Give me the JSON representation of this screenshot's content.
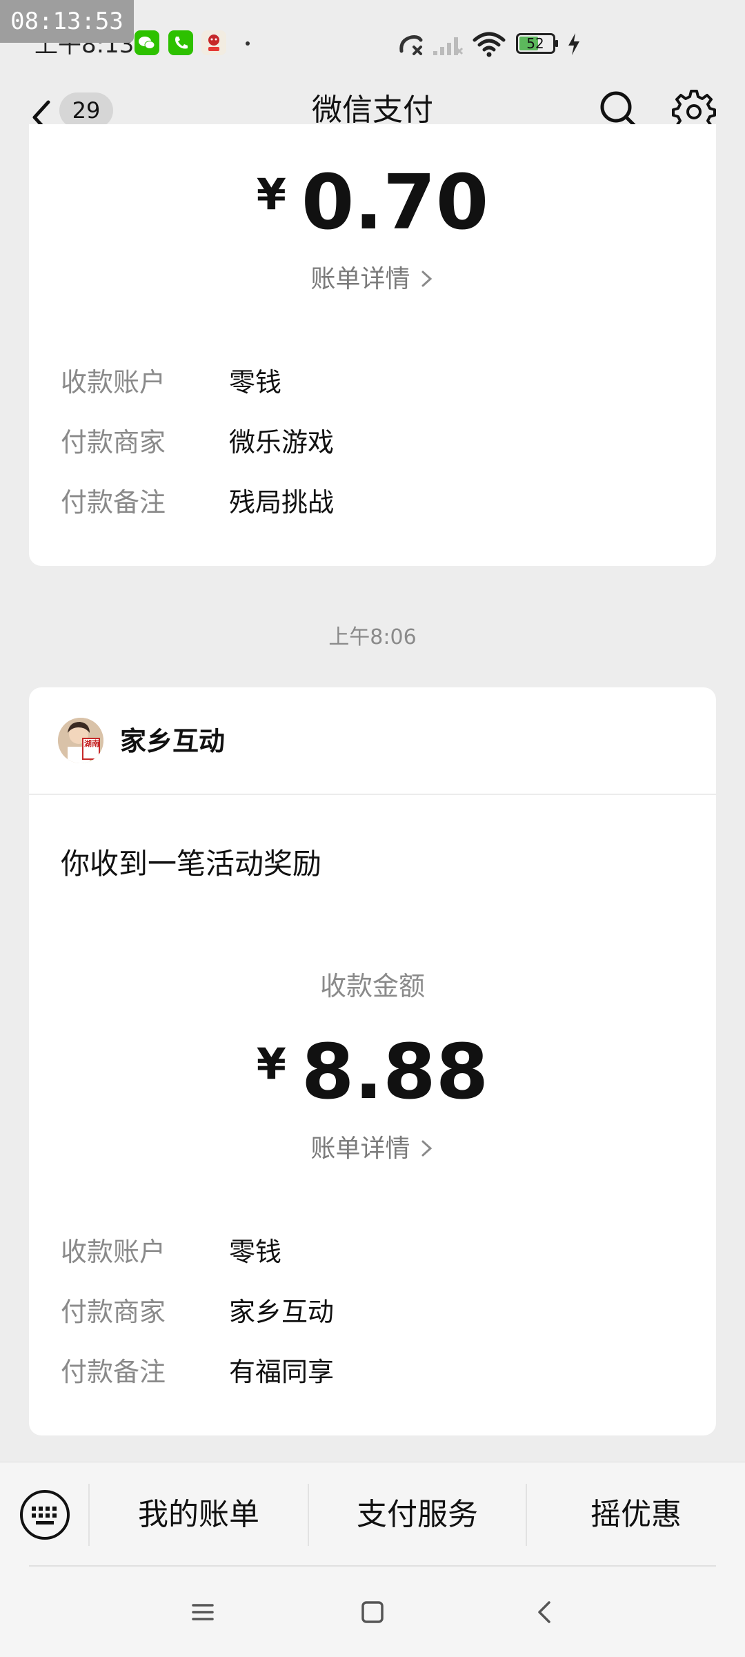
{
  "status_bar": {
    "overlay_clock": "08:13:53",
    "time": "上午8:13",
    "battery": "52"
  },
  "header": {
    "unread_count": "29",
    "title": "微信支付"
  },
  "card_top": {
    "amount": "0.70",
    "currency": "¥",
    "detail_link": "账单详情",
    "rows": [
      {
        "label": "收款账户",
        "value": "零钱"
      },
      {
        "label": "付款商家",
        "value": "微乐游戏"
      },
      {
        "label": "付款备注",
        "value": "残局挑战"
      }
    ]
  },
  "timestamp": "上午8:06",
  "card_bottom": {
    "merchant_name": "家乡互动",
    "avatar_text": "湖南",
    "message": "你收到一笔活动奖励",
    "amount_label": "收款金额",
    "amount": "8.88",
    "currency": "¥",
    "detail_link": "账单详情",
    "rows": [
      {
        "label": "收款账户",
        "value": "零钱"
      },
      {
        "label": "付款商家",
        "value": "家乡互动"
      },
      {
        "label": "付款备注",
        "value": "有福同享"
      }
    ]
  },
  "bottom_menu": {
    "items": [
      "我的账单",
      "支付服务",
      "摇优惠"
    ]
  },
  "colors": {
    "background": "#ededed",
    "card": "#ffffff",
    "secondary_text": "#8a8a8a",
    "wechat_green": "#2dc100"
  }
}
